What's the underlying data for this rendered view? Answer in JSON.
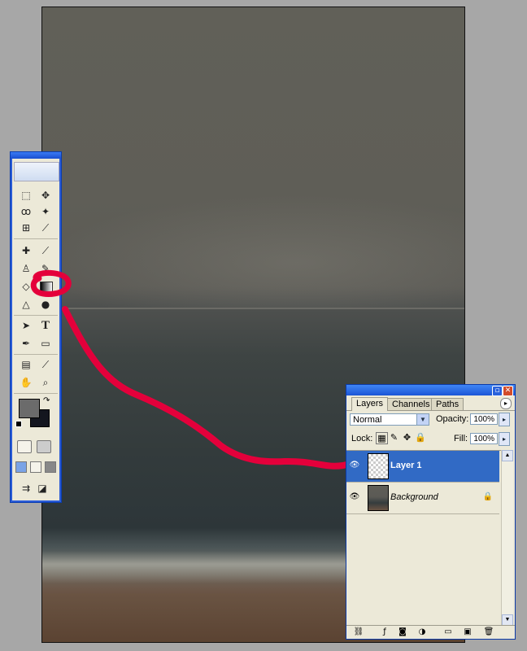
{
  "toolbox": {
    "tools_left": [
      "marquee-icon",
      "lasso-icon",
      "crop-icon",
      "healing-brush-icon",
      "clone-stamp-icon",
      "eraser-icon",
      "blur-icon",
      "path-select-icon",
      "pen-icon",
      "notes-icon",
      "hand-icon"
    ],
    "tools_right": [
      "move-icon",
      "magic-wand-icon",
      "slice-icon",
      "brush-icon",
      "history-brush-icon",
      "gradient-icon",
      "dodge-icon",
      "type-icon",
      "shape-icon",
      "eyedropper-icon",
      "zoom-icon"
    ],
    "glyphs_left": [
      "⬚",
      "✓",
      "⊡",
      "✚",
      "♙",
      "◇",
      "▲",
      "↖",
      "✒",
      "▤",
      "✋"
    ],
    "glyphs_right": [
      "✥",
      "✦",
      "✎",
      "✎",
      "✎",
      "▣",
      "●",
      "T",
      "▭",
      "✎",
      "🔍"
    ],
    "foreground_color": "#6b6b6b",
    "background_color": "#14161f"
  },
  "annotation": {
    "color": "#e8003c"
  },
  "layers_panel": {
    "tabs": [
      "Layers",
      "Channels",
      "Paths"
    ],
    "blend_mode": "Normal",
    "opacity_label": "Opacity:",
    "opacity_value": "100%",
    "lock_label": "Lock:",
    "fill_label": "Fill:",
    "fill_value": "100%",
    "layers": [
      {
        "name": "Layer 1",
        "selected": true,
        "visible": true
      },
      {
        "name": "Background",
        "selected": false,
        "visible": true,
        "locked": true
      }
    ]
  }
}
